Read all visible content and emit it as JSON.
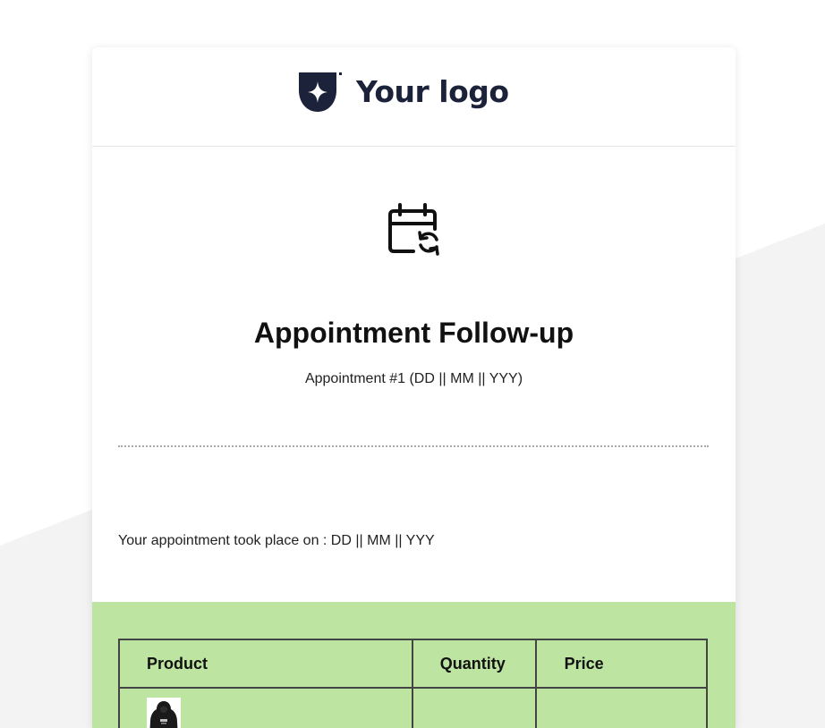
{
  "header": {
    "logo_text": "Your logo",
    "logo_icon": "star-shield-logo-icon"
  },
  "main": {
    "icon": "calendar-sync-icon",
    "title": "Appointment Follow-up",
    "subtitle": "Appointment #1 (DD || MM || YYY)",
    "took_place": "Your appointment took place on : DD || MM || YYY"
  },
  "products": {
    "columns": [
      "Product",
      "Quantity",
      "Price"
    ],
    "rows": [
      {
        "image": "hoodie-product-thumbnail",
        "quantity": "",
        "price": ""
      }
    ]
  },
  "colors": {
    "logo": "#1b2239",
    "green_section": "#bde5a1",
    "table_border": "#444444",
    "divider": "#a9a9a9"
  }
}
